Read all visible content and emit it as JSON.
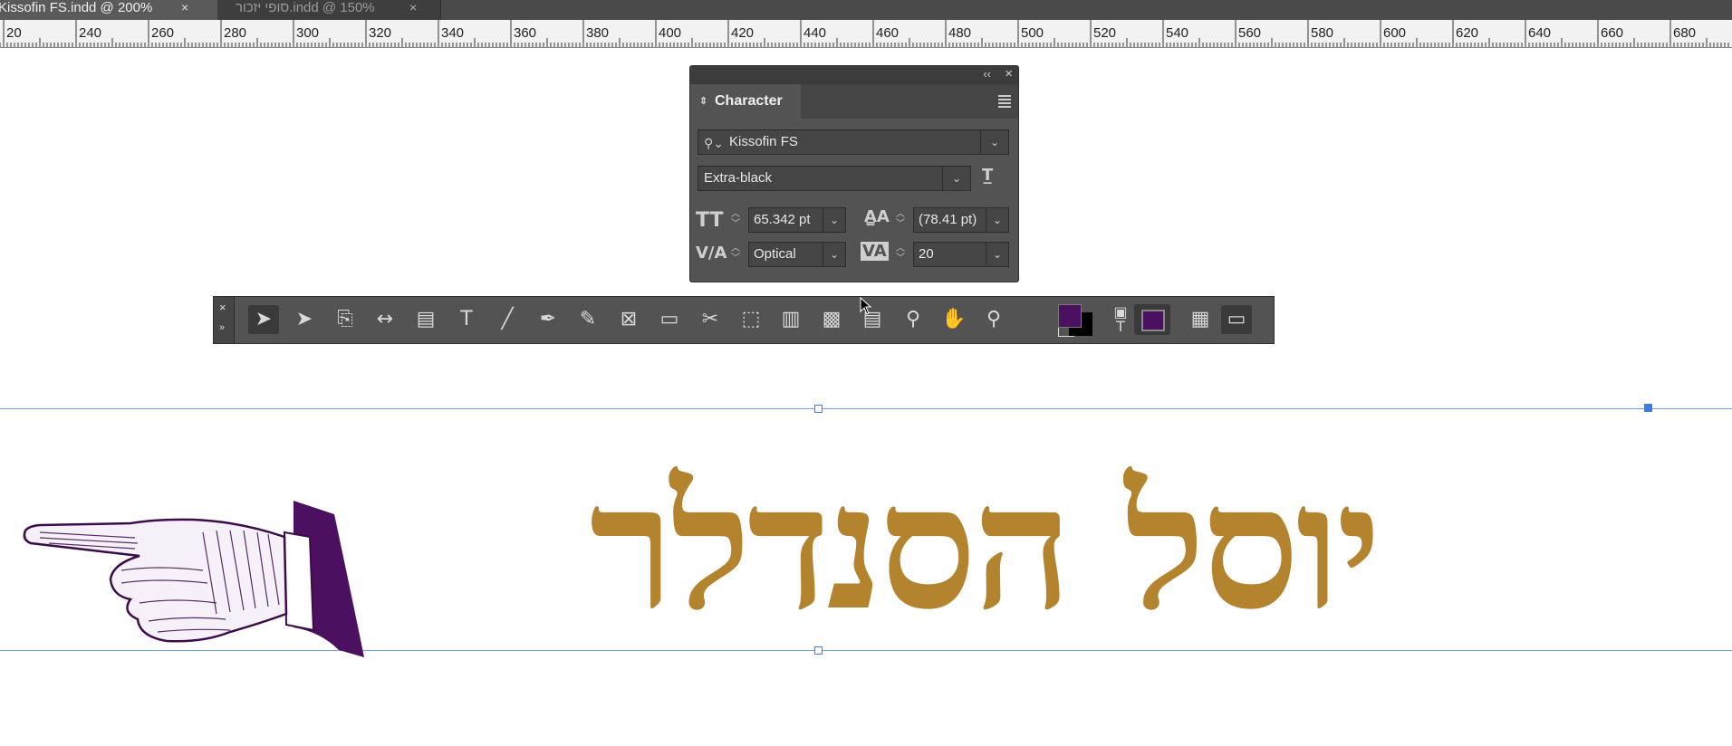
{
  "tabs": [
    {
      "title": "Kissofin FS.indd @ 200%",
      "close": "×",
      "active": true
    },
    {
      "title": "סופי יזכור.indd @ 150%",
      "close": "×",
      "active": false
    }
  ],
  "ruler": {
    "labels": [
      "20",
      "240",
      "260",
      "280",
      "300",
      "320",
      "340",
      "360",
      "380",
      "400",
      "420",
      "440",
      "460",
      "480",
      "500",
      "520",
      "540",
      "560",
      "580",
      "600",
      "620",
      "640",
      "660",
      "680"
    ]
  },
  "character_panel": {
    "title": "Character",
    "collapse_glyph": "‹‹",
    "close_glyph": "×",
    "font_family": "Kissofin FS",
    "font_style": "Extra-black",
    "font_size": "65.342 pt",
    "leading": "(78.41 pt)",
    "kerning": "Optical",
    "tracking": "20",
    "icons": {
      "font_size": "font-size-icon",
      "leading": "leading-icon",
      "kerning": "kerning-icon",
      "tracking": "tracking-icon",
      "style_options": "type-options-icon"
    }
  },
  "tools_panel": {
    "close_glyph": "×",
    "expand_glyph": "»",
    "tools": [
      {
        "name": "selection-tool-icon",
        "glyph": "➤",
        "active": true
      },
      {
        "name": "direct-selection-tool-icon",
        "glyph": "➤"
      },
      {
        "name": "page-tool-icon",
        "glyph": "⎘"
      },
      {
        "name": "gap-tool-icon",
        "glyph": "↔"
      },
      {
        "name": "content-collector-tool-icon",
        "glyph": "▤"
      },
      {
        "name": "type-tool-icon",
        "glyph": "T"
      },
      {
        "name": "line-tool-icon",
        "glyph": "╱"
      },
      {
        "name": "pen-tool-icon",
        "glyph": "✒"
      },
      {
        "name": "pencil-tool-icon",
        "glyph": "✎"
      },
      {
        "name": "rectangle-frame-tool-icon",
        "glyph": "⊠"
      },
      {
        "name": "rectangle-tool-icon",
        "glyph": "▭"
      },
      {
        "name": "scissors-tool-icon",
        "glyph": "✂"
      },
      {
        "name": "free-transform-tool-icon",
        "glyph": "⬚"
      },
      {
        "name": "gradient-swatch-tool-icon",
        "glyph": "▥"
      },
      {
        "name": "gradient-feather-tool-icon",
        "glyph": "▩"
      },
      {
        "name": "note-tool-icon",
        "glyph": "▤"
      },
      {
        "name": "eyedropper-tool-icon",
        "glyph": "⚲"
      },
      {
        "name": "hand-tool-icon",
        "glyph": "✋"
      },
      {
        "name": "zoom-tool-icon",
        "glyph": "⚲"
      }
    ],
    "fill_color": "#4b1060",
    "stroke_color": "#000000"
  },
  "document": {
    "headline": "יוסל הסנדלר",
    "headline_color": "#b4832e",
    "cuff_color": "#4b1060",
    "guide_color": "#6f9ff0"
  }
}
